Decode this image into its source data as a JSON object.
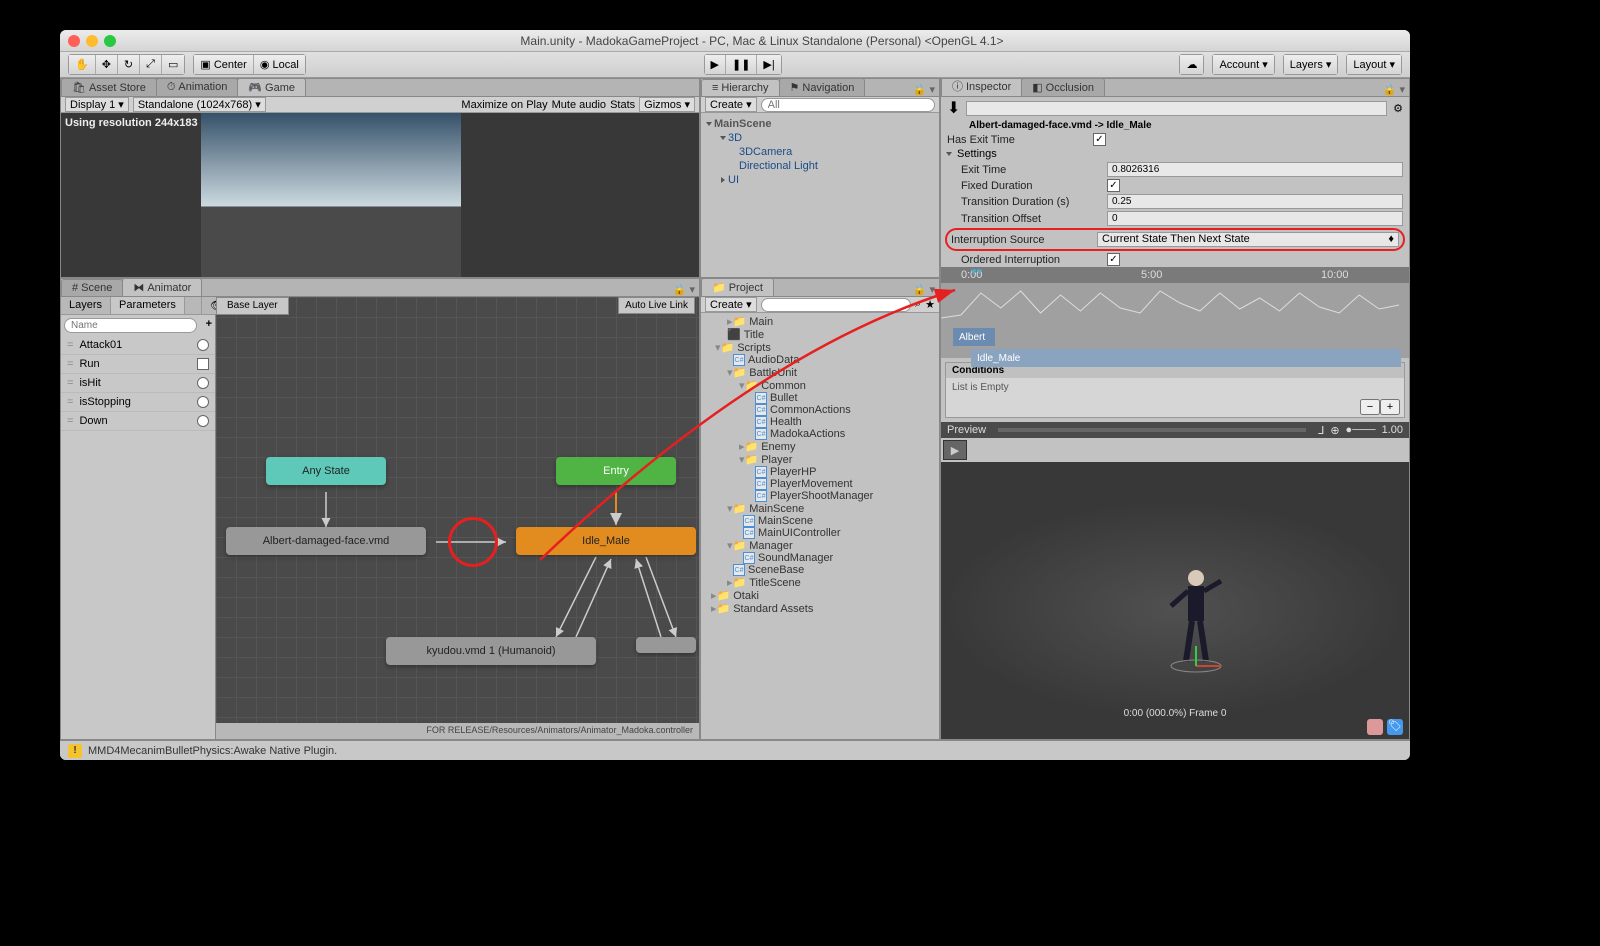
{
  "window": {
    "title": "Main.unity - MadokaGameProject - PC, Mac & Linux Standalone (Personal) <OpenGL 4.1>"
  },
  "toolbar": {
    "center": "Center",
    "local": "Local",
    "account": "Account",
    "layers": "Layers",
    "layout": "Layout"
  },
  "gamePane": {
    "tabs": {
      "assetStore": "Asset Store",
      "animation": "Animation",
      "game": "Game"
    },
    "display": "Display 1",
    "aspect": "Standalone (1024x768)",
    "maxOnPlay": "Maximize on Play",
    "mute": "Mute audio",
    "stats": "Stats",
    "gizmos": "Gizmos",
    "resolution": "Using resolution 244x183"
  },
  "hierarchyPane": {
    "tabs": {
      "hierarchy": "Hierarchy",
      "navigation": "Navigation"
    },
    "create": "Create",
    "items": {
      "root": "MainScene",
      "threeD": "3D",
      "cam": "3DCamera",
      "light": "Directional Light",
      "ui": "UI"
    }
  },
  "inspector": {
    "tabs": {
      "inspector": "Inspector",
      "occlusion": "Occlusion"
    },
    "transition": "Albert-damaged-face.vmd -> Idle_Male",
    "hasExitTime": "Has Exit Time",
    "settings": "Settings",
    "exitTimeLabel": "Exit Time",
    "exitTime": "0.8026316",
    "fixedDuration": "Fixed Duration",
    "transDurLabel": "Transition Duration (s)",
    "transDur": "0.25",
    "transOffLabel": "Transition Offset",
    "transOff": "0",
    "interruptLabel": "Interruption Source",
    "interruptVal": "Current State Then Next State",
    "orderedLabel": "Ordered Interruption",
    "ticks": {
      "t0": "0:00",
      "t1": "5:00",
      "t2": "10:00"
    },
    "clip1": "Albert",
    "clip2": "Idle_Male",
    "condHead": "Conditions",
    "condBody": "List is Empty",
    "preview": "Preview",
    "previewSpeed": "1.00",
    "previewFrame": "0:00 (000.0%) Frame 0"
  },
  "animator": {
    "tabs": {
      "scene": "Scene",
      "animator": "Animator"
    },
    "sideTabs": {
      "layers": "Layers",
      "params": "Parameters"
    },
    "searchPlaceholder": "Name",
    "breadcrumb": "Base Layer",
    "autoLive": "Auto Live Link",
    "params": [
      {
        "name": "Attack01",
        "type": "trigger"
      },
      {
        "name": "Run",
        "type": "bool"
      },
      {
        "name": "isHit",
        "type": "trigger"
      },
      {
        "name": "isStopping",
        "type": "trigger"
      },
      {
        "name": "Down",
        "type": "trigger"
      }
    ],
    "nodes": {
      "any": "Any State",
      "entry": "Entry",
      "albert": "Albert-damaged-face.vmd",
      "idle": "Idle_Male",
      "kyudou": "kyudou.vmd 1 (Humanoid)"
    },
    "pathbar": "FOR RELEASE/Resources/Animators/Animator_Madoka.controller"
  },
  "project": {
    "tab": "Project",
    "create": "Create",
    "tree": {
      "main": "Main",
      "title": "Title",
      "scripts": "Scripts",
      "audioData": "AudioData",
      "battleUnit": "BattleUnit",
      "common": "Common",
      "bullet": "Bullet",
      "commonActions": "CommonActions",
      "health": "Health",
      "madokaActions": "MadokaActions",
      "enemy": "Enemy",
      "player": "Player",
      "playerHP": "PlayerHP",
      "playerMovement": "PlayerMovement",
      "playerShoot": "PlayerShootManager",
      "mainScene": "MainScene",
      "mainSceneCs": "MainScene",
      "mainUI": "MainUIController",
      "manager": "Manager",
      "soundMgr": "SoundManager",
      "sceneBase": "SceneBase",
      "titleScene": "TitleScene",
      "otaki": "Otaki",
      "standard": "Standard Assets"
    }
  },
  "status": "MMD4MecanimBulletPhysics:Awake Native Plugin."
}
